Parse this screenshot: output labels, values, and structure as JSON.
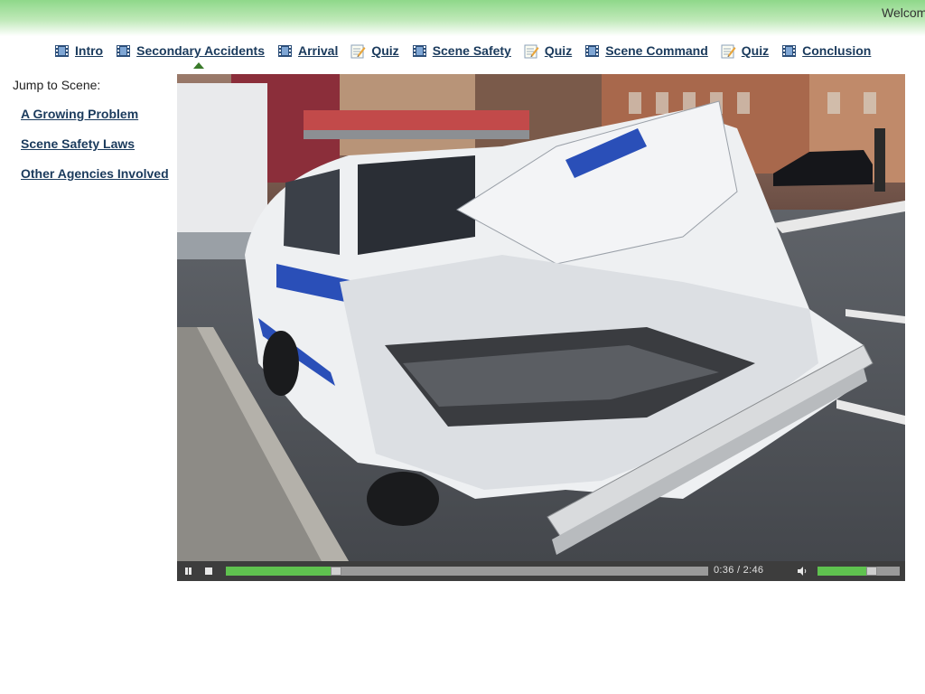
{
  "header": {
    "welcome_text": "Welcom"
  },
  "nav": {
    "items": [
      {
        "label": "Intro",
        "icon": "film-icon"
      },
      {
        "label": "Secondary Accidents",
        "icon": "film-icon"
      },
      {
        "label": "Arrival",
        "icon": "film-icon"
      },
      {
        "label": "Quiz",
        "icon": "quiz-icon"
      },
      {
        "label": "Scene Safety",
        "icon": "film-icon"
      },
      {
        "label": "Quiz",
        "icon": "quiz-icon"
      },
      {
        "label": "Scene Command",
        "icon": "film-icon"
      },
      {
        "label": "Quiz",
        "icon": "quiz-icon"
      },
      {
        "label": "Conclusion",
        "icon": "film-icon"
      }
    ],
    "active_index": 1
  },
  "sidebar": {
    "jump_label": "Jump to Scene:",
    "scenes": [
      "A Growing Problem",
      "Scene Safety Laws",
      "Other Agencies Involved"
    ]
  },
  "player": {
    "video_description_icon": "wrecked-police-car-image",
    "time_display": "0:36 / 2:46",
    "progress_fraction": 0.217,
    "volume_fraction": 0.68,
    "colors": {
      "progress": "#5fc24f",
      "controls_bg": "#3d3d3d"
    }
  }
}
